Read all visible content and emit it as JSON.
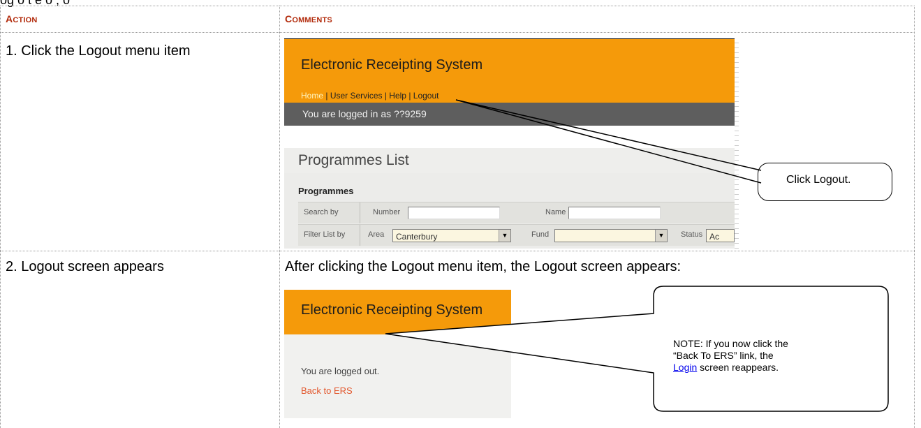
{
  "page_top_fragment": "og o t e o   ,   o",
  "columns": {
    "action_first": "A",
    "action_rest": "CTION",
    "comments_first": "C",
    "comments_rest": "OMMENTS"
  },
  "rows": [
    {
      "action": "1. Click the Logout menu item",
      "screenshot": {
        "app_title": "Electronic Receipting System",
        "menu": {
          "home": "Home",
          "sep": " | ",
          "user_services": "User Services",
          "help": "Help",
          "logout": "Logout"
        },
        "logged_in_text": "You are logged in as ??9259",
        "list_title": "Programmes List",
        "section_label": "Programmes",
        "search_by": "Search by",
        "number_label": "Number",
        "name_label": "Name",
        "filter_by": "Filter List by",
        "area_label": "Area",
        "area_value": "Canterbury",
        "fund_label": "Fund",
        "status_label": "Status",
        "status_value": "Ac"
      },
      "callout": "Click Logout."
    },
    {
      "action": "2. Logout screen appears",
      "intro": "After clicking the Logout menu item, the Logout screen appears:",
      "screenshot": {
        "app_title": "Electronic Receipting System",
        "logged_out_text": "You are logged out.",
        "back_link": "Back to ERS"
      },
      "callout": {
        "line1": "NOTE:  If you now click the",
        "line2": "“Back To ERS” link, the",
        "login_link": "Login",
        "line3_rest": " screen reappears."
      }
    }
  ],
  "colors": {
    "accent_header": "#b22a0b",
    "ers_orange": "#f59a0a",
    "link_blue": "#0000ee"
  }
}
